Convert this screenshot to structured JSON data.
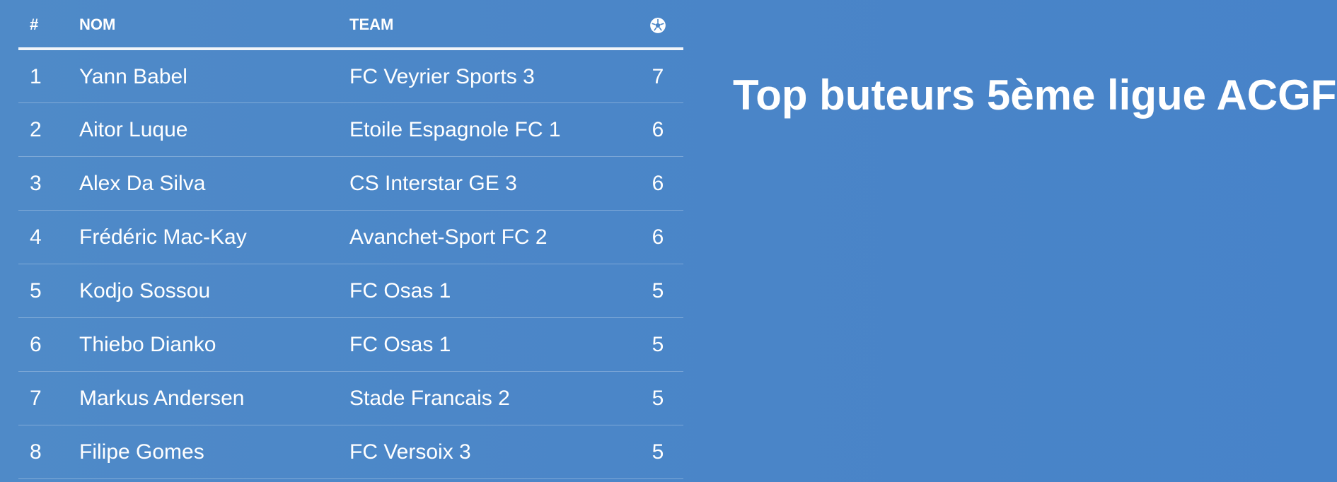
{
  "table": {
    "headers": {
      "rank": "#",
      "name": "NOM",
      "team": "TEAM",
      "goals_icon": "soccer-ball-icon"
    },
    "rows": [
      {
        "rank": "1",
        "name": "Yann Babel",
        "team": "FC Veyrier Sports 3",
        "goals": "7"
      },
      {
        "rank": "2",
        "name": "Aitor Luque",
        "team": "Etoile Espagnole FC 1",
        "goals": "6"
      },
      {
        "rank": "3",
        "name": "Alex Da Silva",
        "team": "CS Interstar GE 3",
        "goals": "6"
      },
      {
        "rank": "4",
        "name": "Frédéric Mac-Kay",
        "team": "Avanchet-Sport FC 2",
        "goals": "6"
      },
      {
        "rank": "5",
        "name": "Kodjo Sossou",
        "team": "FC Osas 1",
        "goals": "5"
      },
      {
        "rank": "6",
        "name": "Thiebo Dianko",
        "team": "FC Osas 1",
        "goals": "5"
      },
      {
        "rank": "7",
        "name": "Markus Andersen",
        "team": "Stade Francais 2",
        "goals": "5"
      },
      {
        "rank": "8",
        "name": "Filipe Gomes",
        "team": "FC Versoix 3",
        "goals": "5"
      }
    ]
  },
  "title": "Top buteurs 5ème ligue ACGF",
  "colors": {
    "background": "#4b86c8",
    "text": "#ffffff",
    "header_rule": "#f2f5f9"
  }
}
